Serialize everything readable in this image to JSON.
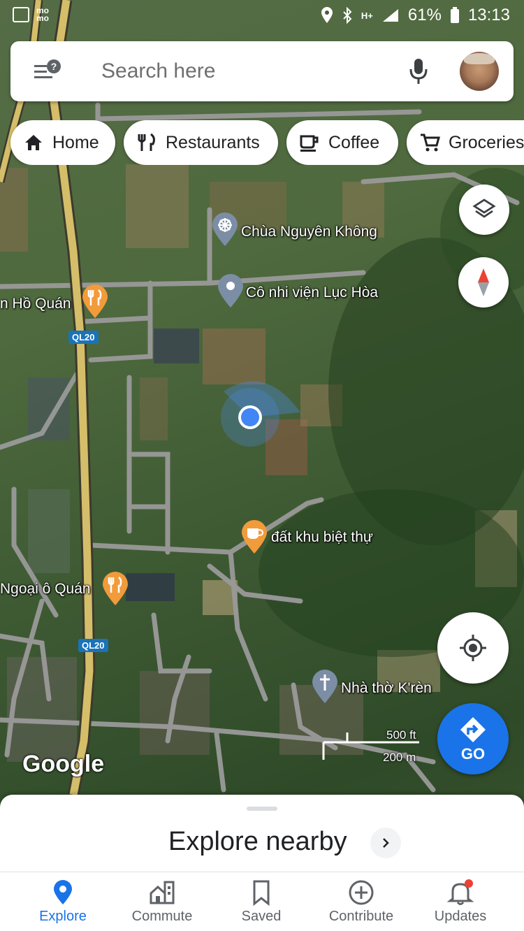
{
  "status_bar": {
    "momo_label": "mo mo",
    "battery_percent": "61%",
    "time": "13:13",
    "network_label": "H+"
  },
  "search": {
    "placeholder": "Search here"
  },
  "chips": [
    {
      "label": "Home",
      "icon": "home-icon"
    },
    {
      "label": "Restaurants",
      "icon": "restaurant-icon"
    },
    {
      "label": "Coffee",
      "icon": "coffee-icon"
    },
    {
      "label": "Groceries",
      "icon": "cart-icon"
    }
  ],
  "map": {
    "places": [
      {
        "name": "Chùa Nguyên Không",
        "icon": "temple-pin-icon"
      },
      {
        "name": "Cô nhi viện Lục Hòa",
        "icon": "place-pin-icon"
      },
      {
        "name": "n Hồ Quán",
        "icon": "restaurant-pin-icon"
      },
      {
        "name": "đất khu biệt thự",
        "icon": "coffee-pin-icon"
      },
      {
        "name": "Ngoại ô Quán",
        "icon": "restaurant-pin-icon"
      },
      {
        "name": "Nhà thờ K'rèn",
        "icon": "church-pin-icon"
      }
    ],
    "road_shields": [
      "QL20",
      "QL20"
    ],
    "logo": "Google",
    "scale": {
      "imperial": "500 ft",
      "metric": "200 m"
    }
  },
  "fabs": {
    "layers_icon": "layers-icon",
    "compass_icon": "compass-icon",
    "location_icon": "my-location-icon",
    "go_label": "GO"
  },
  "explore": {
    "title": "Explore nearby"
  },
  "bottom_nav": [
    {
      "label": "Explore",
      "icon": "explore-pin-icon",
      "active": true
    },
    {
      "label": "Commute",
      "icon": "commute-icon",
      "active": false
    },
    {
      "label": "Saved",
      "icon": "bookmark-icon",
      "active": false
    },
    {
      "label": "Contribute",
      "icon": "add-circle-icon",
      "active": false
    },
    {
      "label": "Updates",
      "icon": "bell-icon",
      "active": false
    }
  ],
  "colors": {
    "accent": "#1a73e8",
    "notification_dot": "#ea4335",
    "pin_orange": "#f29b3b",
    "pin_gray": "#7c8ea5"
  }
}
